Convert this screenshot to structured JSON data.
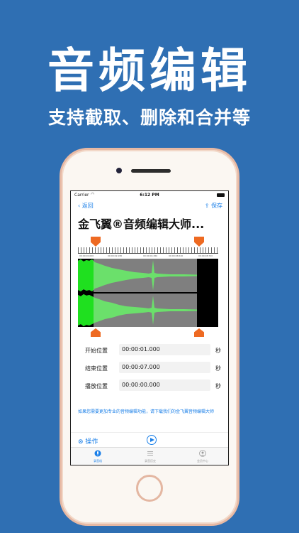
{
  "promo": {
    "headline": "音频编辑",
    "subline": "支持截取、删除和合并等"
  },
  "status_bar": {
    "carrier": "Carrier",
    "time": "6:12 PM"
  },
  "nav": {
    "back_label": "返回",
    "save_label": "保存"
  },
  "app_title": "金飞翼®音频编辑大师...",
  "ruler_labels": [
    "00:00:00.000",
    "00:00:02.180",
    "00:00:04.360",
    "00:00:06.540",
    "00:00:08.720"
  ],
  "selection": {
    "start_seconds": 1.0,
    "end_seconds": 7.0,
    "total_seconds": 8.72
  },
  "fields": [
    {
      "label": "开始位置",
      "value": "00:00:01.000",
      "unit": "秒"
    },
    {
      "label": "结束位置",
      "value": "00:00:07.000",
      "unit": "秒"
    },
    {
      "label": "播放位置",
      "value": "00:00:00.000",
      "unit": "秒"
    }
  ],
  "note": "如果您需要更加专业的音频编辑功能，请下载我们的金飞翼音频编辑大师",
  "action": {
    "label": "操作"
  },
  "tabs": [
    {
      "label": "录音机",
      "icon": "mic-icon",
      "active": true
    },
    {
      "label": "录音历史",
      "icon": "list-icon",
      "active": false
    },
    {
      "label": "会员中心",
      "icon": "user-icon",
      "active": false
    }
  ],
  "colors": {
    "background": "#2f6fb3",
    "accent": "#1a7fe8",
    "marker": "#ee6a22",
    "wave_selected": "#6be06b",
    "wave_bright": "#1fe01f",
    "wave_bg_selected": "#7f7f7f"
  }
}
